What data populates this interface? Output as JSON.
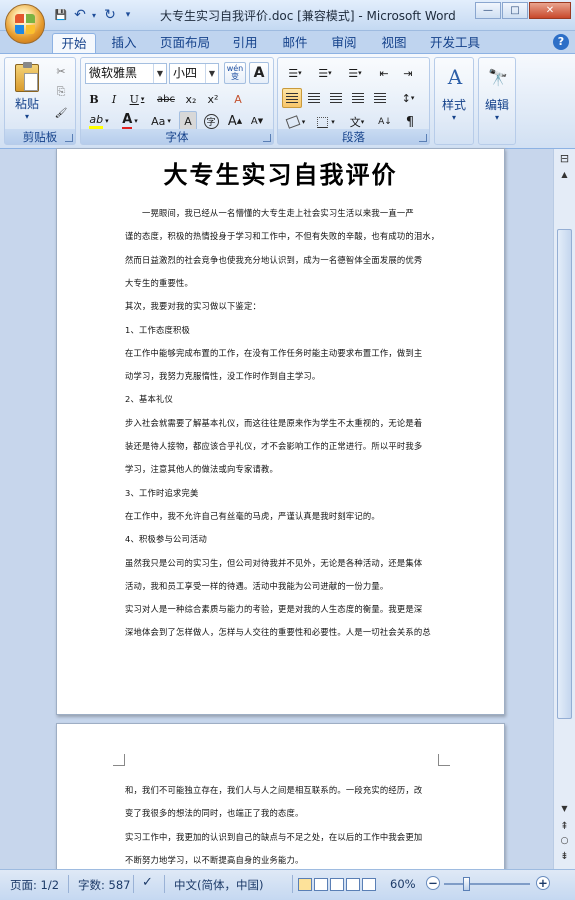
{
  "window": {
    "title": "大专生实习自我评价.doc [兼容模式] - Microsoft Word",
    "min_glyph": "—",
    "max_glyph": "□",
    "close_glyph": "✕"
  },
  "qat": {
    "save_glyph": "💾",
    "undo_glyph": "↶",
    "undo_drop": "▾",
    "redo_glyph": "↻",
    "customize_glyph": "▾"
  },
  "tabs": [
    "开始",
    "插入",
    "页面布局",
    "引用",
    "邮件",
    "审阅",
    "视图",
    "开发工具"
  ],
  "help_glyph": "?",
  "ribbon": {
    "clipboard": {
      "label": "剪贴板",
      "paste_label": "粘贴",
      "paste_drop": "▾",
      "cut_glyph": "✂",
      "copy_glyph": "⎘",
      "painter_glyph": "🖌"
    },
    "font": {
      "label": "字体",
      "font_name": "微软雅黑",
      "font_size": "小四",
      "wen_label": "wén\n变",
      "bold": "B",
      "italic": "I",
      "underline": "U",
      "strike": "abc",
      "sub": "x₂",
      "sup": "x²",
      "clear": "A",
      "highlight": "ab",
      "font_color": "A",
      "change_case": "Aa",
      "char_shade": "A",
      "enclose": "字",
      "grow": "A",
      "shrink": "A",
      "a_box": "A"
    },
    "paragraph": {
      "label": "段落",
      "bullets": "☰",
      "numbering": "☰",
      "multilevel": "☰",
      "dec_indent": "⇤",
      "inc_indent": "⇥",
      "chinese_layout": "文",
      "sort": "A↓",
      "show_marks": "¶",
      "line_spacing": "↕"
    },
    "styles": {
      "label": "样式",
      "glyph": "A"
    },
    "editing": {
      "label": "编辑",
      "glyph": "🔭"
    }
  },
  "document": {
    "title": "大专生实习自我评价",
    "page1_lines": [
      "　　一晃眼间，我已经从一名懵懂的大专生走上社会实习生活以来我一直一严",
      "谨的态度，积极的热情投身于学习和工作中，不但有失败的辛酸，也有成功的泪水，",
      "然而日益激烈的社会竞争也使我充分地认识到，成为一名德智体全面发展的优秀",
      "大专生的重要性。",
      "其次，我要对我的实习做以下鉴定：",
      "1、工作态度积极",
      "在工作中能够完成布置的工作，在没有工作任务时能主动要求布置工作，做到主",
      "动学习，我努力克服惰性，没工作时作到自主学习。",
      "2、基本礼仪",
      "步入社会就需要了解基本礼仪，而这往往是原来作为学生不太重视的，无论是着",
      "装还是待人接物，都应该合乎礼仪，才不会影响工作的正常进行。所以平时我多",
      "学习，注意其他人的做法或向专家请教。",
      "3、工作时追求完美",
      "在工作中，我不允许自己有丝毫的马虎，严谨认真是我时刻牢记的。",
      "4、积极参与公司活动",
      "虽然我只是公司的实习生，但公司对待我并不见外，无论是各种活动，还是集体",
      "活动，我和员工享受一样的待遇。活动中我能为公司进献的一份力量。",
      "实习对人是一种综合素质与能力的考验，更是对我的人生态度的衡量。我更是深",
      "深地体会到了怎样做人，怎样与人交往的重要性和必要性。人是一切社会关系的总"
    ],
    "page2_lines": [
      "和，我们不可能独立存在，我们人与人之间是相互联系的。一段充实的经历，改",
      "变了我很多的想法的同时，也端正了我的态度。",
      "实习工作中，我更加的认识到自己的缺点与不足之处，在以后的工作中我会更加",
      "不断努力地学习，以不断提高自身的业务能力。"
    ]
  },
  "scrollbar": {
    "ruler_glyph": "⊟",
    "up_glyph": "▲",
    "down_glyph": "▼",
    "prev_page_glyph": "⇞",
    "browse_glyph": "○",
    "next_page_glyph": "⇟"
  },
  "status": {
    "page": "页面: 1/2",
    "words": "字数: 587",
    "proof_glyph": "✓",
    "language": "中文(简体，中国)",
    "zoom": "60%",
    "zoom_out": "−",
    "zoom_in": "+"
  }
}
